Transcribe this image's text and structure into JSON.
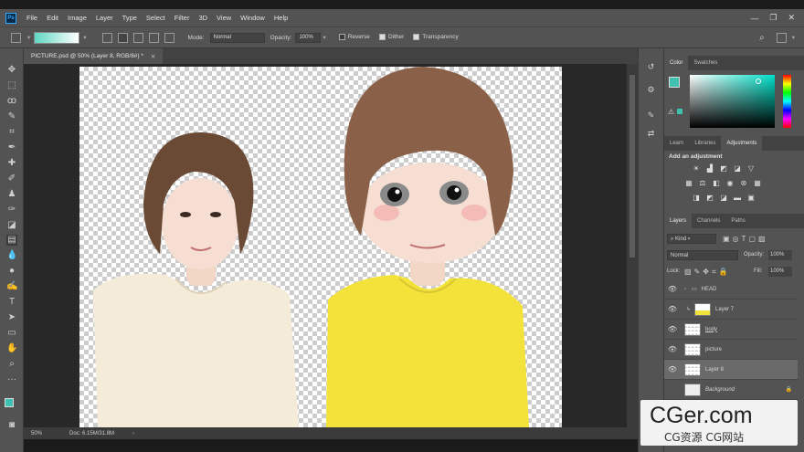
{
  "menu": [
    "File",
    "Edit",
    "Image",
    "Layer",
    "Type",
    "Select",
    "Filter",
    "3D",
    "View",
    "Window",
    "Help"
  ],
  "window_controls": {
    "minimize": "—",
    "restore": "❐",
    "close": "✕"
  },
  "options": {
    "mode_label": "Mode:",
    "mode_value": "Normal",
    "opacity_label": "Opacity:",
    "opacity_value": "100%",
    "reverse": "Reverse",
    "dither": "Dither",
    "transparency": "Transparency",
    "gradient_colors": [
      "#5fd6c3",
      "#ffffff"
    ]
  },
  "document_tab": {
    "title": "PICTURE.psd @ 50% (Layer 8, RGB/8#) *",
    "close": "✕"
  },
  "status": {
    "zoom": "50%",
    "doc": "Doc: 6.15M/31.8M"
  },
  "color_panel": {
    "tabs": [
      "Color",
      "Swatches"
    ],
    "foreground": "#40c0b0",
    "background": "#ffffff"
  },
  "adjust_panel": {
    "tabs": [
      "Learn",
      "Libraries",
      "Adjustments"
    ],
    "heading": "Add an adjustment"
  },
  "layers_panel": {
    "tabs": [
      "Layers",
      "Channels",
      "Paths"
    ],
    "filter": "Kind",
    "blend": "Normal",
    "opacity_label": "Opacity:",
    "opacity_value": "100%",
    "lock_label": "Lock:",
    "fill_label": "Fill:",
    "fill_value": "100%",
    "layers": [
      {
        "name": "HEAD",
        "type": "group"
      },
      {
        "name": "Layer 7",
        "type": "layer"
      },
      {
        "name": "body",
        "type": "layer"
      },
      {
        "name": "picture",
        "type": "layer"
      },
      {
        "name": "Layer 8",
        "type": "layer"
      },
      {
        "name": "Background",
        "type": "background"
      }
    ]
  },
  "watermark": {
    "main": "CGer.com",
    "sub": "CG资源 CG网站"
  }
}
